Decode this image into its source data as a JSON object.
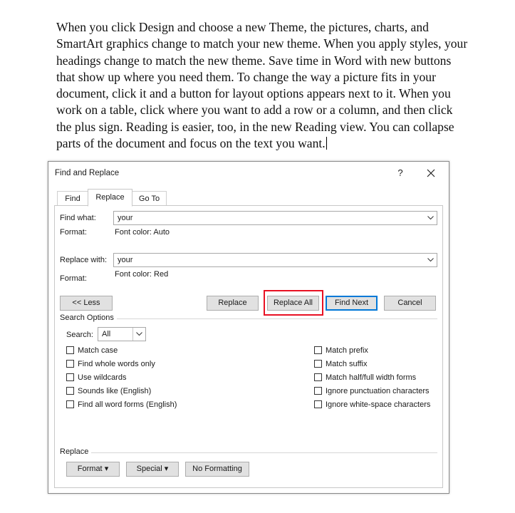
{
  "document": {
    "paragraph": "When you click Design and choose a new Theme, the pictures, charts, and SmartArt graphics change to match your new theme. When you apply styles, your headings change to match the new theme. Save time in Word with new buttons that show up where you need them. To change the way a picture fits in your document, click it and a button for layout options appears next to it. When you work on a table, click where you want to add a row or a column, and then click the plus sign. Reading is easier, too, in the new Reading view. You can collapse parts of the document and focus on the text you want."
  },
  "dialog": {
    "title": "Find and Replace",
    "help": "?",
    "close_icon": "close-icon",
    "tabs": [
      {
        "label": "Find",
        "active": false
      },
      {
        "label": "Replace",
        "active": true
      },
      {
        "label": "Go To",
        "active": false
      }
    ],
    "find_what": {
      "label": "Find what:",
      "value": "your",
      "format_label": "Format:",
      "format_value": "Font color: Auto"
    },
    "replace_with": {
      "label": "Replace with:",
      "value": "your",
      "format_label": "Format:",
      "format_value": "Font color: Red"
    },
    "buttons": {
      "less": "<< Less",
      "replace": "Replace",
      "replace_all": "Replace All",
      "find_next": "Find Next",
      "cancel": "Cancel"
    },
    "highlight_color": "#e81123",
    "search_options": {
      "title": "Search Options",
      "search_label": "Search:",
      "search_value": "All",
      "left_options": [
        "Match case",
        "Find whole words only",
        "Use wildcards",
        "Sounds like (English)",
        "Find all word forms (English)"
      ],
      "right_options": [
        "Match prefix",
        "Match suffix",
        "Match half/full width forms",
        "Ignore punctuation characters",
        "Ignore white-space characters"
      ]
    },
    "replace_group": {
      "title": "Replace",
      "format": "Format",
      "special": "Special",
      "no_formatting": "No Formatting"
    }
  }
}
